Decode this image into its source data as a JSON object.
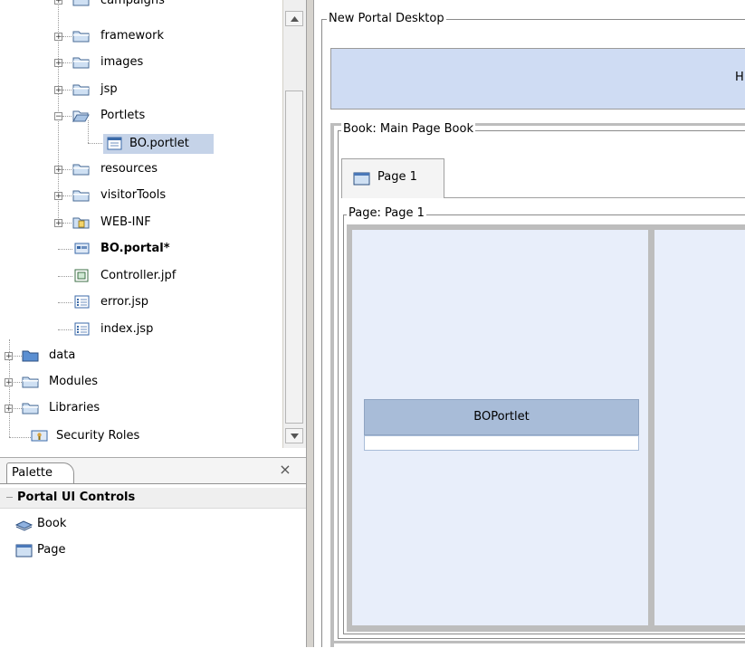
{
  "tree": {
    "items": [
      {
        "label": "campaigns",
        "icon": "folder-icon",
        "expander": "+"
      },
      {
        "label": "framework",
        "icon": "folder-icon",
        "expander": "+"
      },
      {
        "label": "images",
        "icon": "folder-icon",
        "expander": "+"
      },
      {
        "label": "jsp",
        "icon": "folder-icon",
        "expander": "+"
      },
      {
        "label": "Portlets",
        "icon": "open-folder-icon",
        "expander": "−"
      },
      {
        "label": "BO.portlet",
        "icon": "portlet-file-icon",
        "expander": ""
      },
      {
        "label": "resources",
        "icon": "folder-icon",
        "expander": "+"
      },
      {
        "label": "visitorTools",
        "icon": "folder-icon",
        "expander": "+"
      },
      {
        "label": "WEB-INF",
        "icon": "web-inf-folder-icon",
        "expander": "+"
      },
      {
        "label": "BO.portal*",
        "icon": "portal-file-icon",
        "expander": ""
      },
      {
        "label": "Controller.jpf",
        "icon": "controller-file-icon",
        "expander": ""
      },
      {
        "label": "error.jsp",
        "icon": "jsp-file-icon",
        "expander": ""
      },
      {
        "label": "index.jsp",
        "icon": "jsp-file-icon",
        "expander": ""
      },
      {
        "label": "data",
        "icon": "data-folder-icon",
        "expander": "+"
      },
      {
        "label": "Modules",
        "icon": "folder-icon",
        "expander": "+"
      },
      {
        "label": "Libraries",
        "icon": "folder-icon",
        "expander": "+"
      },
      {
        "label": "Security Roles",
        "icon": "security-roles-icon",
        "expander": ""
      }
    ]
  },
  "palette": {
    "tab_label": "Palette",
    "close_glyph": "×",
    "section_title": "Portal UI Controls",
    "items": [
      {
        "label": "Book",
        "icon": "book-icon"
      },
      {
        "label": "Page",
        "icon": "page-icon"
      }
    ]
  },
  "editor": {
    "desktop_title": "New Portal Desktop",
    "header_text": "H",
    "book_title": "Book: Main Page Book",
    "tab_label": "Page 1",
    "page_title": "Page: Page 1",
    "portlet_title": "BOPortlet"
  },
  "colors": {
    "selection": "#c5d3e8",
    "header_band": "#cfdcf3",
    "column_bg": "#e8eefa",
    "portlet_header": "#a8bcd8"
  }
}
